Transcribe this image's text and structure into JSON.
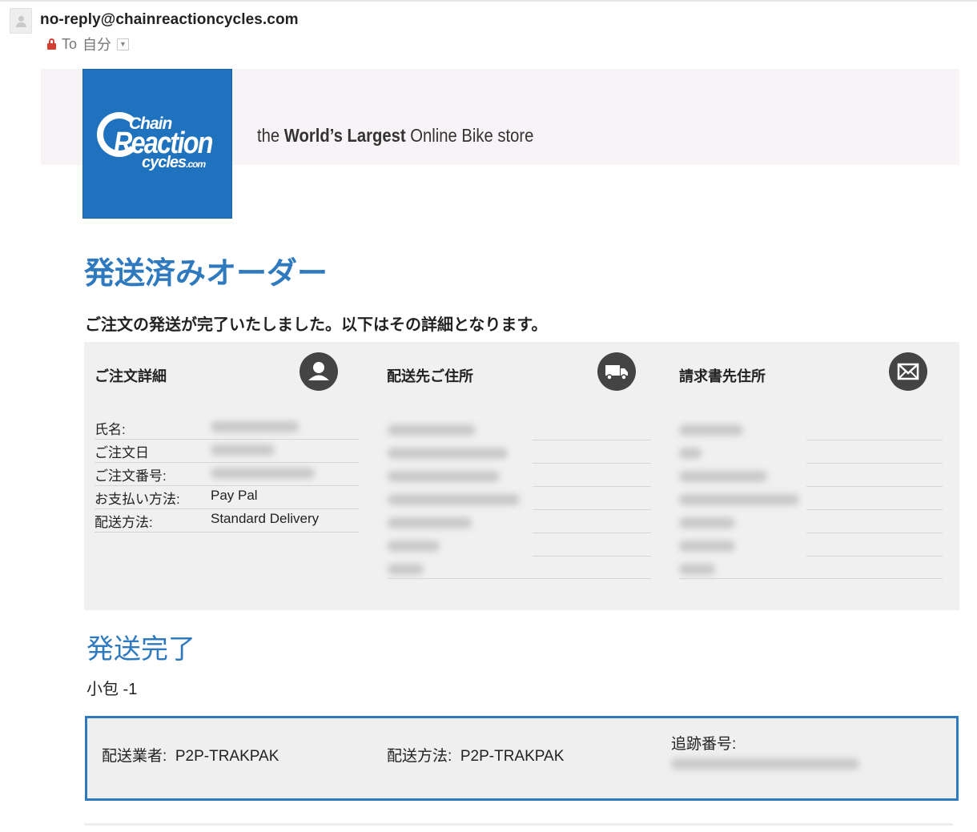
{
  "email": {
    "sender": "no-reply@chainreactioncycles.com",
    "to_label": "To",
    "recipient": "自分"
  },
  "banner": {
    "logo_line1": "Chain",
    "logo_line2": "Reaction",
    "logo_line3": "cycles",
    "logo_line3_suffix": ".com",
    "tagline_pre": "the ",
    "tagline_bold": "World’s Largest",
    "tagline_post": " Online Bike store",
    "background": "#f7f3f7",
    "logo_color": "#1f72bd"
  },
  "title": "発送済みオーダー",
  "subtitle": "ご注文の発送が完了いたしました。以下はその詳細となります。",
  "order_details": {
    "heading": "ご注文詳細",
    "icon": "user-icon",
    "rows": [
      {
        "label": "氏名:",
        "value": ""
      },
      {
        "label": "ご注文日",
        "value": ""
      },
      {
        "label": "ご注文番号:",
        "value": ""
      },
      {
        "label": "お支払い方法:",
        "value": "Pay Pal"
      },
      {
        "label": "配送方法:",
        "value": "Standard Delivery"
      }
    ]
  },
  "shipping_address": {
    "heading": "配送先ご住所",
    "icon": "truck-icon"
  },
  "billing_address": {
    "heading": "請求書先住所",
    "icon": "envelope-icon"
  },
  "shipment": {
    "heading": "発送完了",
    "parcel": "小包 -1",
    "carrier_label": "配送業者:",
    "carrier_value": "P2P-TRAKPAK",
    "method_label": "配送方法:",
    "method_value": "P2P-TRAKPAK",
    "tracking_label": "追跡番号:",
    "border_color": "#2f7abf"
  },
  "colors": {
    "accent": "#2f7abf",
    "panel": "#f0f0f0",
    "icon_circle": "#444444"
  }
}
